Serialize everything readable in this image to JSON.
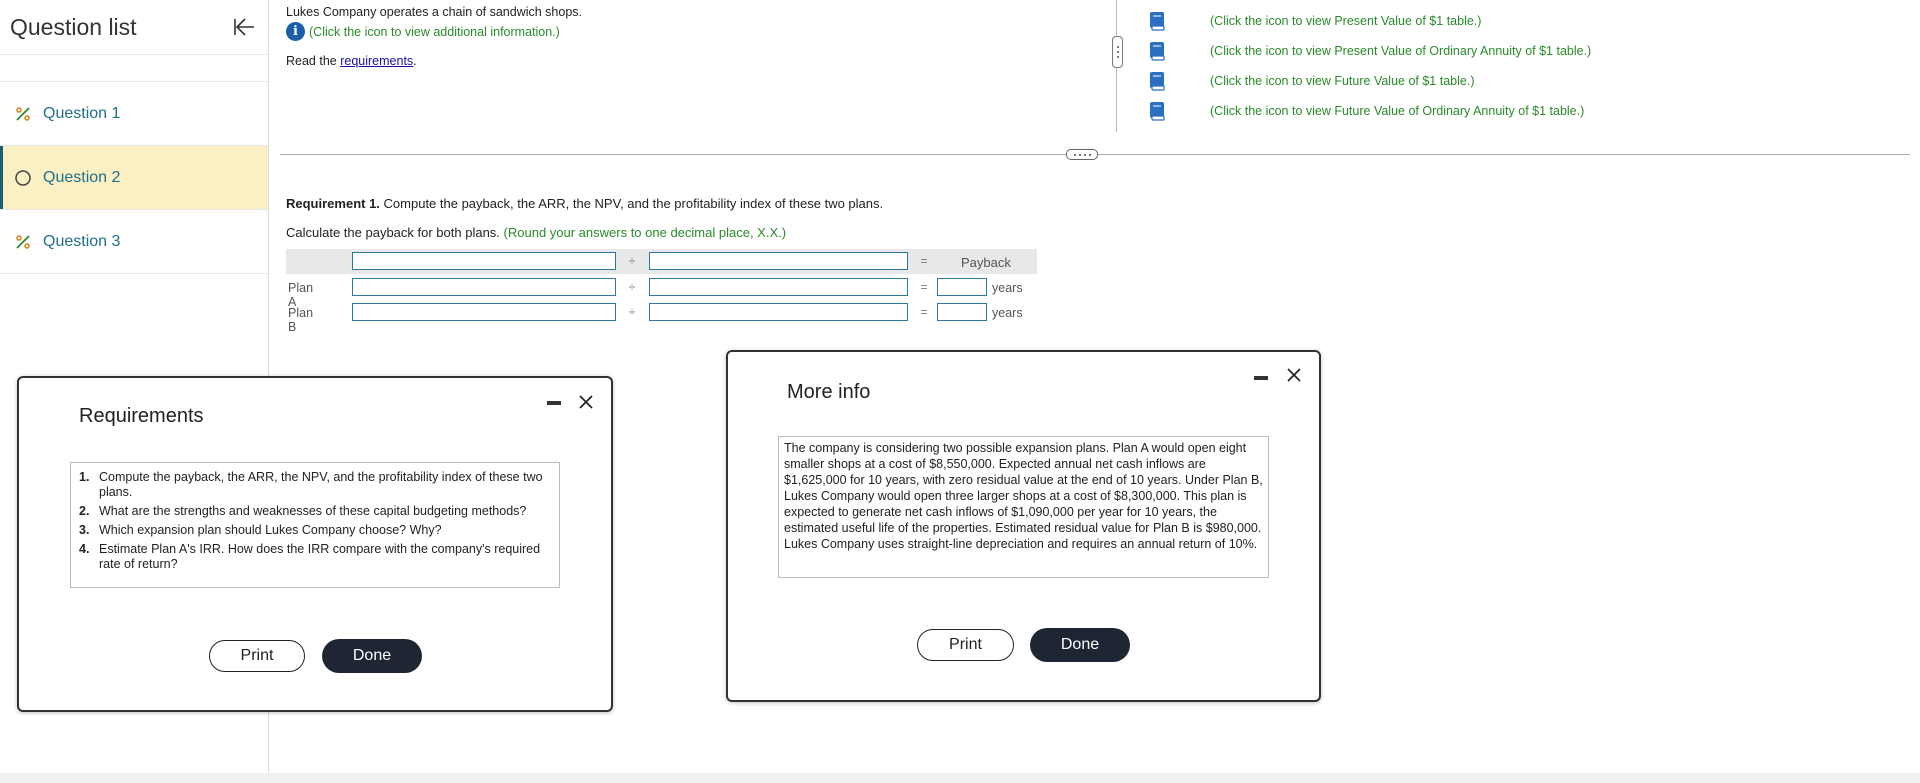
{
  "sidebar": {
    "title": "Question list",
    "items": [
      {
        "label": "Question 1",
        "status": "partial"
      },
      {
        "label": "Question 2",
        "status": "unanswered"
      },
      {
        "label": "Question 3",
        "status": "partial"
      }
    ]
  },
  "problem": {
    "intro": "Lukes Company operates a chain of sandwich shops.",
    "info_link": "(Click the icon to view additional information.)",
    "read_prefix": "Read the ",
    "read_link": "requirements",
    "read_suffix": "."
  },
  "tables": [
    {
      "label": "(Click the icon to view Present Value of $1 table.)"
    },
    {
      "label": "(Click the icon to view Present Value of Ordinary Annuity of $1 table.)"
    },
    {
      "label": "(Click the icon to view Future Value of $1 table.)"
    },
    {
      "label": "(Click the icon to view Future Value of Ordinary Annuity of $1 table.)"
    }
  ],
  "requirement": {
    "title_bold": "Requirement 1.",
    "title_rest": " Compute the payback, the ARR, the NPV, and the profitability index of these two plans.",
    "calc_text": "Calculate the payback for both plans. ",
    "calc_hint": "(Round your answers to one decimal place, X.X.)"
  },
  "grid": {
    "divide_symbol": "÷",
    "equals_symbol": "=",
    "payback_header": "Payback",
    "rows": [
      {
        "label": "Plan A",
        "unit": "years"
      },
      {
        "label": "Plan B",
        "unit": "years"
      }
    ]
  },
  "requirements_dialog": {
    "title": "Requirements",
    "items": [
      {
        "num": "1.",
        "text": "Compute the payback, the ARR, the NPV, and the profitability index of these two plans."
      },
      {
        "num": "2.",
        "text": "What are the strengths and weaknesses of these capital budgeting methods?"
      },
      {
        "num": "3.",
        "text": "Which expansion plan should Lukes Company choose? Why?"
      },
      {
        "num": "4.",
        "text": "Estimate Plan A's IRR. How does the IRR compare with the company's required rate of return?"
      }
    ],
    "print_label": "Print",
    "done_label": "Done"
  },
  "moreinfo_dialog": {
    "title": "More info",
    "text": "The company is considering two possible expansion plans. Plan A would open eight smaller shops at a cost of $8,550,000. Expected annual net cash inflows are $1,625,000 for 10 years, with zero residual value at the end of 10 years. Under Plan B, Lukes Company would open three larger shops at a cost of $8,300,000. This plan is expected to generate net cash inflows of $1,090,000 per year for 10 years, the estimated useful life of the properties. Estimated residual value for Plan B is $980,000. Lukes Company uses straight-line depreciation and requires an annual return of 10%.",
    "print_label": "Print",
    "done_label": "Done"
  },
  "colors": {
    "accent_teal": "#1f6f8b",
    "active_bg": "#fbf0c4",
    "hint_green": "#2a8a2a",
    "done_bg": "#1e2634",
    "info_blue": "#1b5fa6"
  }
}
